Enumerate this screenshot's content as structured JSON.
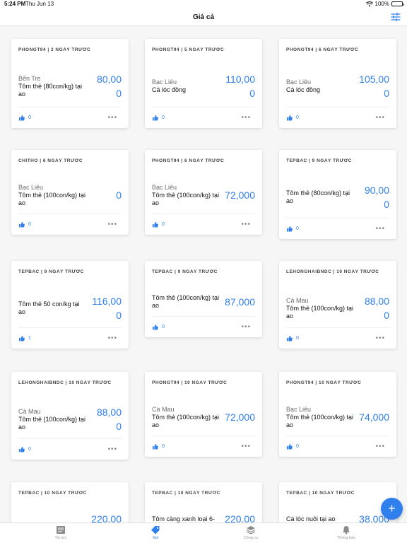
{
  "status": {
    "time": "5:24 PM",
    "date": "Thu Jun 13",
    "battery": "100%"
  },
  "header": {
    "title": "Giá cả"
  },
  "like_icon_color": "#2f80ed",
  "accent_color": "#2f80ed",
  "cards": [
    {
      "head": "PHONGT94 | 2 NGÀY TRƯỚC",
      "location": "Bến Tre",
      "name": "Tôm thẻ (80con/kg) tại ao",
      "price": "80,00",
      "price2": "0",
      "likes": "0"
    },
    {
      "head": "PHONGT94 | 5 NGÀY TRƯỚC",
      "location": "Bạc Liêu",
      "name": "Cá lóc đồng",
      "price": "110,00",
      "price2": "0",
      "likes": "0"
    },
    {
      "head": "PHONGT94 | 6 NGÀY TRƯỚC",
      "location": "Bạc Liêu",
      "name": "Cá lóc đồng",
      "price": "105,00",
      "price2": "0",
      "likes": "0"
    },
    {
      "head": "CHITHO | 6 NGÀY TRƯỚC",
      "location": "Bạc Liêu",
      "name": "Tôm thẻ (100con/kg) tại ao",
      "price": "0",
      "price2": "",
      "likes": "0"
    },
    {
      "head": "PHONGT94 | 6 NGÀY TRƯỚC",
      "location": "Bạc Liêu",
      "name": "Tôm thẻ (100con/kg) tại ao",
      "price": "72,000",
      "price2": "",
      "likes": "0"
    },
    {
      "head": "TEPBAC | 9 NGÀY TRƯỚC",
      "location": "",
      "name": "Tôm thẻ (80con/kg) tại ao",
      "price": "90,00",
      "price2": "0",
      "likes": "0"
    },
    {
      "head": "TEPBAC | 9 NGÀY TRƯỚC",
      "location": "",
      "name": "Tôm thẻ 50 con/kg tại ao",
      "price": "116,00",
      "price2": "0",
      "likes": "1"
    },
    {
      "head": "TEPBAC | 9 NGÀY TRƯỚC",
      "location": "",
      "name": "Tôm thẻ (100con/kg) tại ao",
      "price": "87,000",
      "price2": "",
      "likes": "0"
    },
    {
      "head": "LEHONGHAIBNDC | 10 NGÀY TRƯỚC",
      "location": "Cà Mau",
      "name": "Tôm thẻ (100con/kg) tại ao",
      "price": "88,00",
      "price2": "0",
      "likes": "0"
    },
    {
      "head": "LEHONGHAIBNDC | 10 NGÀY TRƯỚC",
      "location": "Cà Mau",
      "name": "Tôm thẻ (100con/kg) tại ao",
      "price": "88,00",
      "price2": "0",
      "likes": "0"
    },
    {
      "head": "PHONGT94 | 10 NGÀY TRƯỚC",
      "location": "Cà Mau",
      "name": "Tôm thẻ (100con/kg) tại ao",
      "price": "72,000",
      "price2": "",
      "likes": "0"
    },
    {
      "head": "PHONGT94 | 10 NGÀY TRƯỚC",
      "location": "Bạc Liêu",
      "name": "Tôm thẻ (100con/kg) tại ao",
      "price": "74,000",
      "price2": "",
      "likes": "0"
    },
    {
      "head": "TEPBAC | 10 NGÀY TRƯỚC",
      "location": "",
      "name": "",
      "price": "220,00",
      "price2": "",
      "likes": ""
    },
    {
      "head": "TEPBAC | 10 NGÀY TRƯỚC",
      "location": "",
      "name": "Tôm càng xanh loại 6-",
      "price": "220,00",
      "price2": "",
      "likes": ""
    },
    {
      "head": "TEPBAC | 10 NGÀY TRƯỚC",
      "location": "",
      "name": "Cá lóc nuôi tại ao",
      "price": "38,000",
      "price2": "",
      "likes": ""
    }
  ],
  "fab": {
    "label": "+"
  },
  "tabs": [
    {
      "label": "Tin tức",
      "icon": "newspaper-icon"
    },
    {
      "label": "Giá",
      "icon": "price-tag-icon"
    },
    {
      "label": "Công cụ",
      "icon": "layers-icon"
    },
    {
      "label": "Thông báo",
      "icon": "bell-icon"
    }
  ]
}
